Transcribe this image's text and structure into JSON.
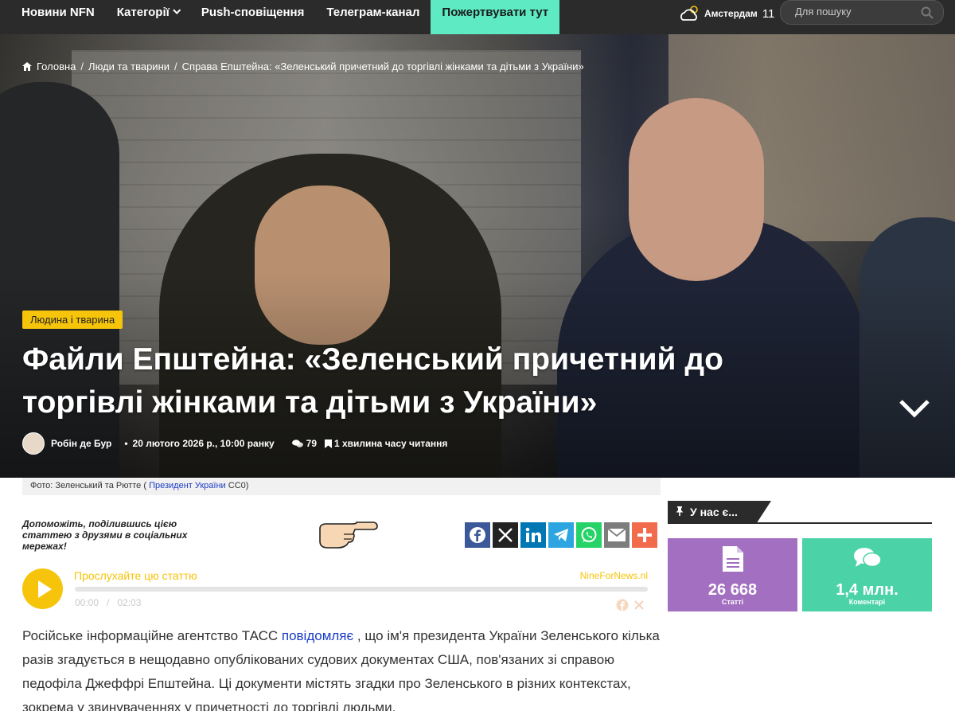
{
  "nav": {
    "items": [
      {
        "label": "Новини NFN"
      },
      {
        "label": "Категорії",
        "has_dropdown": true
      },
      {
        "label": "Push-сповіщення"
      },
      {
        "label": "Телеграм-канал"
      }
    ],
    "donate_label": "Пожертвувати тут",
    "donate_color": "#5eeac3",
    "weather": {
      "city": "Амстердам",
      "temp": "11",
      "icon": "cloud-sun-icon"
    },
    "search": {
      "placeholder": "Для пошуку",
      "icon": "search-icon"
    }
  },
  "breadcrumb": {
    "home": "Головна",
    "section": "Люди та тварини",
    "current": "Справа Епштейна: «Зеленський причетний до торгівлі жінками та дітьми з України»"
  },
  "article": {
    "category": "Людина і тварина",
    "category_color": "#f6c40a",
    "title": "Файли Епштейна: «Зеленський причетний до торгівлі жінками та дітьми з України»",
    "author": "Робін де Бур",
    "date": "20 лютого 2026 р., 10:00 ранку",
    "comments": "79",
    "read_time": "1 хвилина часу читання",
    "caption_prefix": "Фото: Зеленський та Рютте (",
    "caption_link": "Президент України",
    "caption_suffix": "CC0)"
  },
  "share": {
    "prompt": "Допоможіть, поділившись цією статтею з друзями в соціальних мережах!",
    "buttons": [
      {
        "name": "facebook",
        "color": "#3b5998"
      },
      {
        "name": "x",
        "color": "#222222"
      },
      {
        "name": "linkedin",
        "color": "#0077b5"
      },
      {
        "name": "telegram",
        "color": "#2ca5e0"
      },
      {
        "name": "whatsapp",
        "color": "#25d366"
      },
      {
        "name": "email",
        "color": "#7d7d7d"
      },
      {
        "name": "more",
        "color": "#f26b4c"
      }
    ]
  },
  "audio": {
    "title": "Прослухайте цю статтю",
    "brand": "NineForNews.nl",
    "current_time": "00:00",
    "duration": "02:03",
    "progress": 0
  },
  "body": {
    "p1_before": "Російське інформаційне агентство ТАСС ",
    "p1_link": "повідомляє",
    "p1_after": " , що ім'я президента України Зеленського кілька разів згадується в нещодавно опублікованих судових документах США, пов'язаних зі справою педофіла Джеффрі Епштейна. Ці документи містять згадки про Зеленського в різних контекстах, зокрема у звинуваченнях у причетності до торгівлі людьми."
  },
  "sidebar": {
    "heading": "У нас є...",
    "articles": {
      "value": "26 668",
      "label": "Статті",
      "color": "#a36fc1"
    },
    "comments": {
      "value": "1,4 млн.",
      "label": "Коментарі",
      "color": "#4bd3a7"
    }
  }
}
